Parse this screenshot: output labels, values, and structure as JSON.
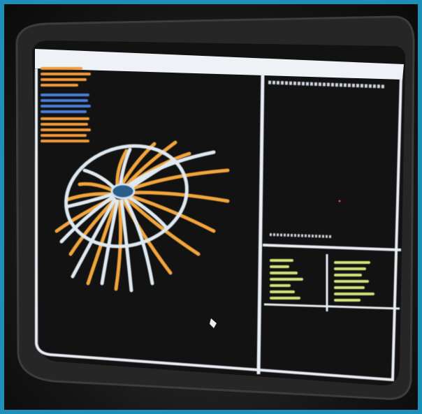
{
  "photo": {
    "subject": "crt-monitor-displaying-3d-wireframe",
    "colors": {
      "border": "#1e8fb8",
      "screen_bg": "#121212",
      "frame_line": "#e9eef4",
      "wire_white": "#dfe9f2",
      "wire_orange": "#f2a53c",
      "text_green": "#cfe37a",
      "text_orange": "#f29a3c",
      "text_blue": "#4a7fd6"
    }
  }
}
